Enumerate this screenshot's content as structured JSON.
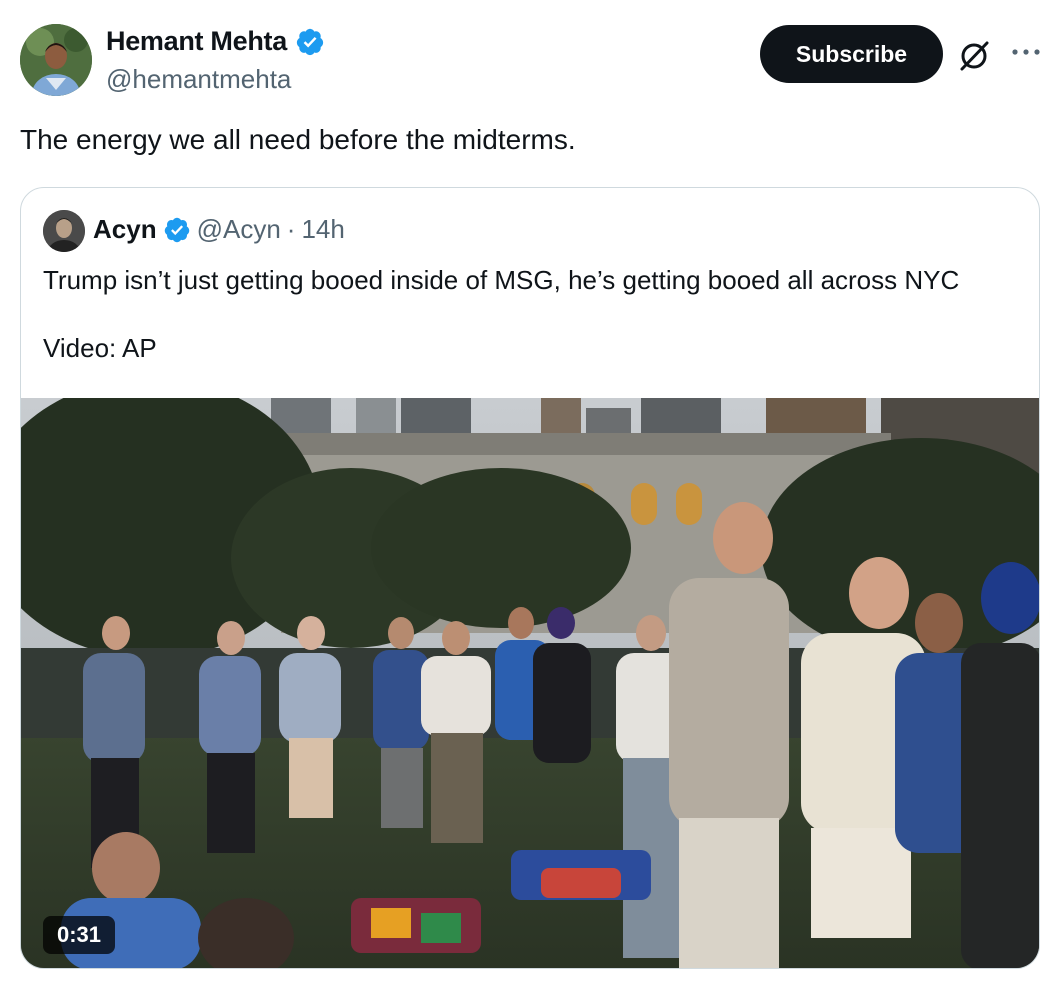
{
  "post": {
    "author_name": "Hemant Mehta",
    "author_handle": "@hemantmehta",
    "subscribe_label": "Subscribe",
    "text": "The energy we all need before the midterms.",
    "icons": [
      "verified-badge-icon",
      "grok-icon",
      "more-icon"
    ]
  },
  "quoted": {
    "author_name": "Acyn",
    "author_handle": "@Acyn",
    "separator": "·",
    "time": "14h",
    "text_line1": "Trump isn’t just getting booed inside of MSG, he’s getting booed all across NYC",
    "text_line2": "Video: AP",
    "video_duration": "0:31"
  },
  "colors": {
    "text_primary": "#0f1419",
    "text_secondary": "#536471",
    "verified_blue": "#1d9bf0",
    "button_dark": "#0f1419",
    "border": "#cfd9de"
  }
}
